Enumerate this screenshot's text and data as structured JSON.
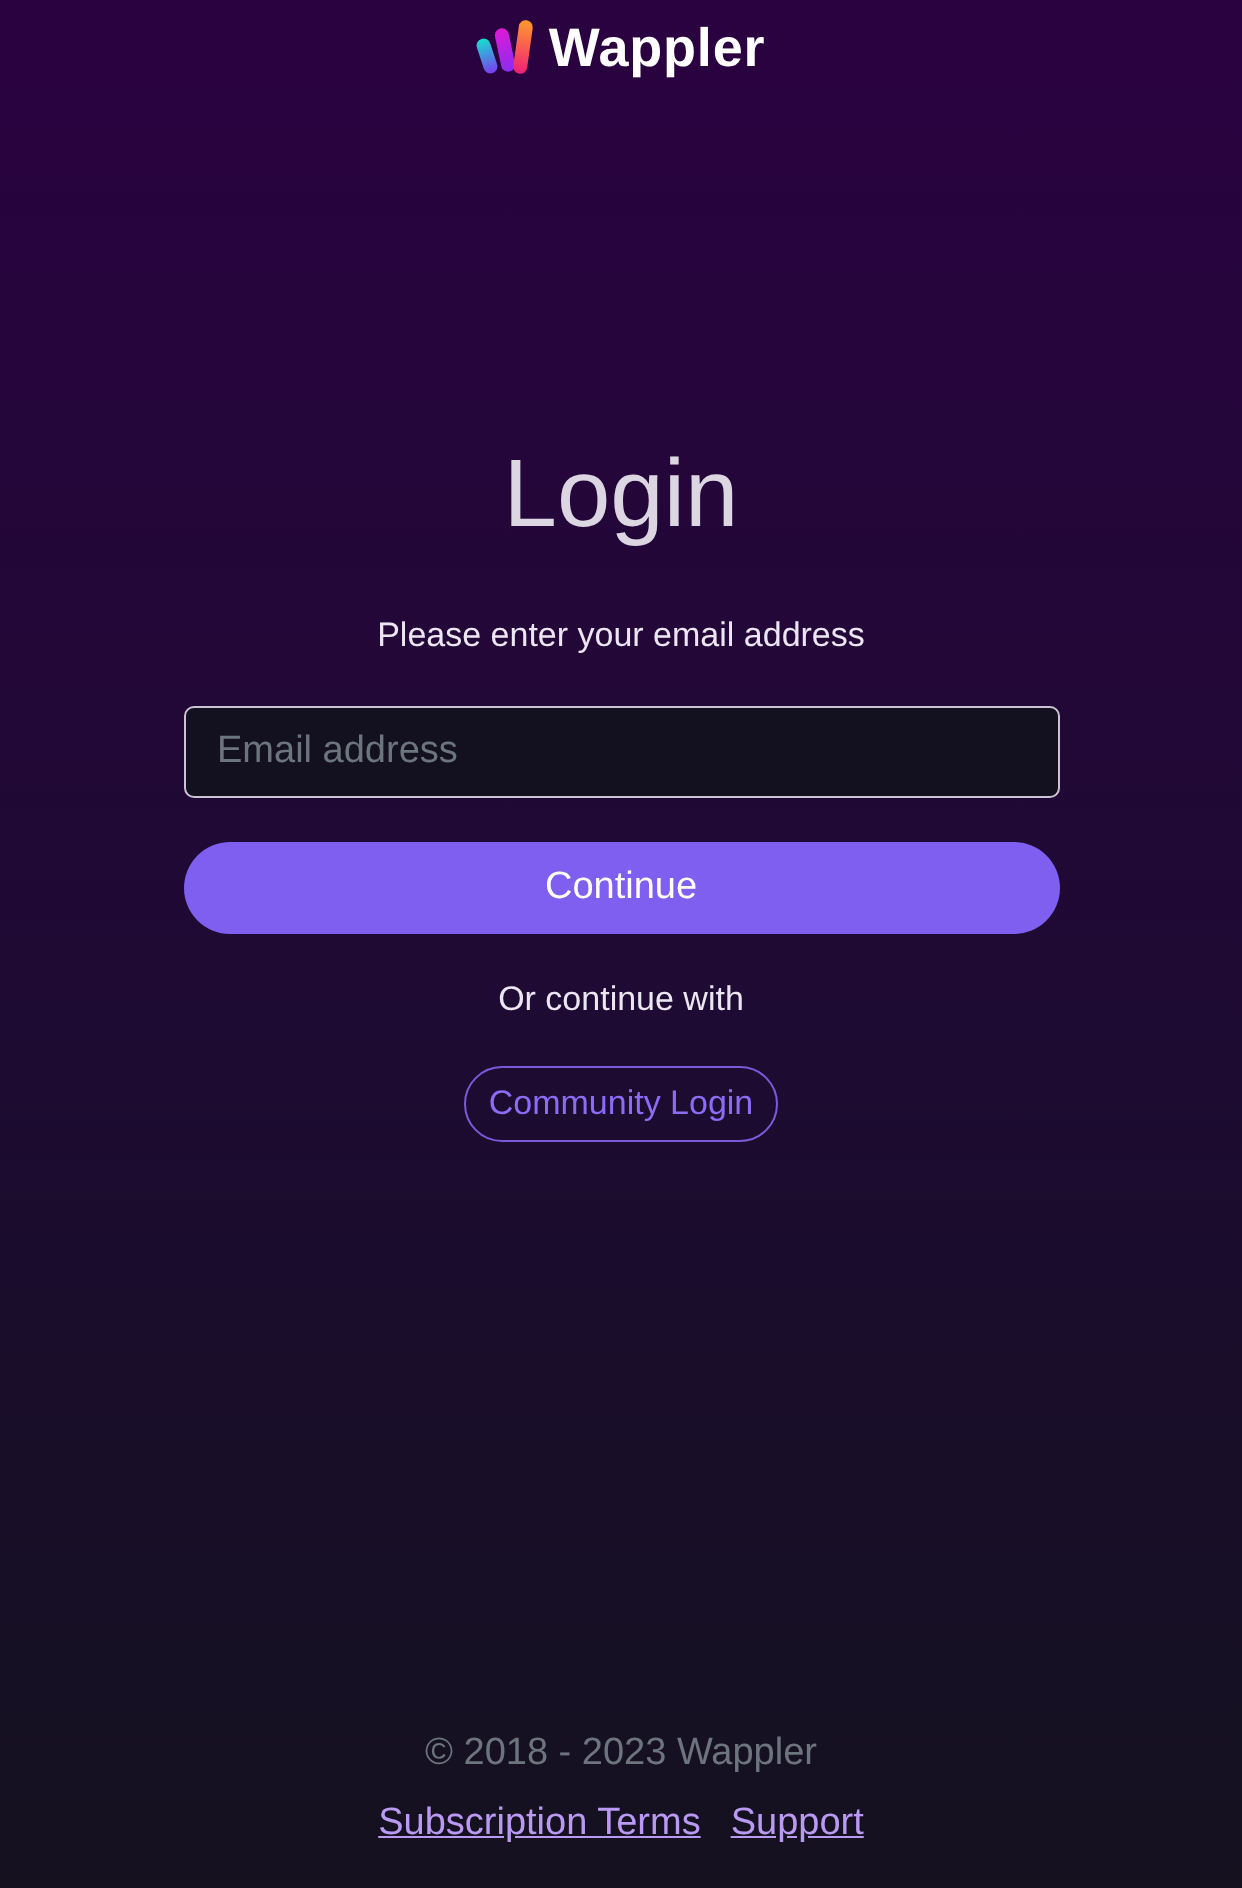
{
  "header": {
    "logo_text": "Wappler"
  },
  "login": {
    "title": "Login",
    "subtitle": "Please enter your email address",
    "email_field": {
      "placeholder": "Email address"
    },
    "continue_button": "Continue",
    "alt_text": "Or continue with",
    "alt_buttons": [
      "Community Login"
    ]
  },
  "footer": {
    "copyright": "© 2018 - 2023 Wappler",
    "links": [
      "Subscription Terms",
      "Support"
    ]
  }
}
